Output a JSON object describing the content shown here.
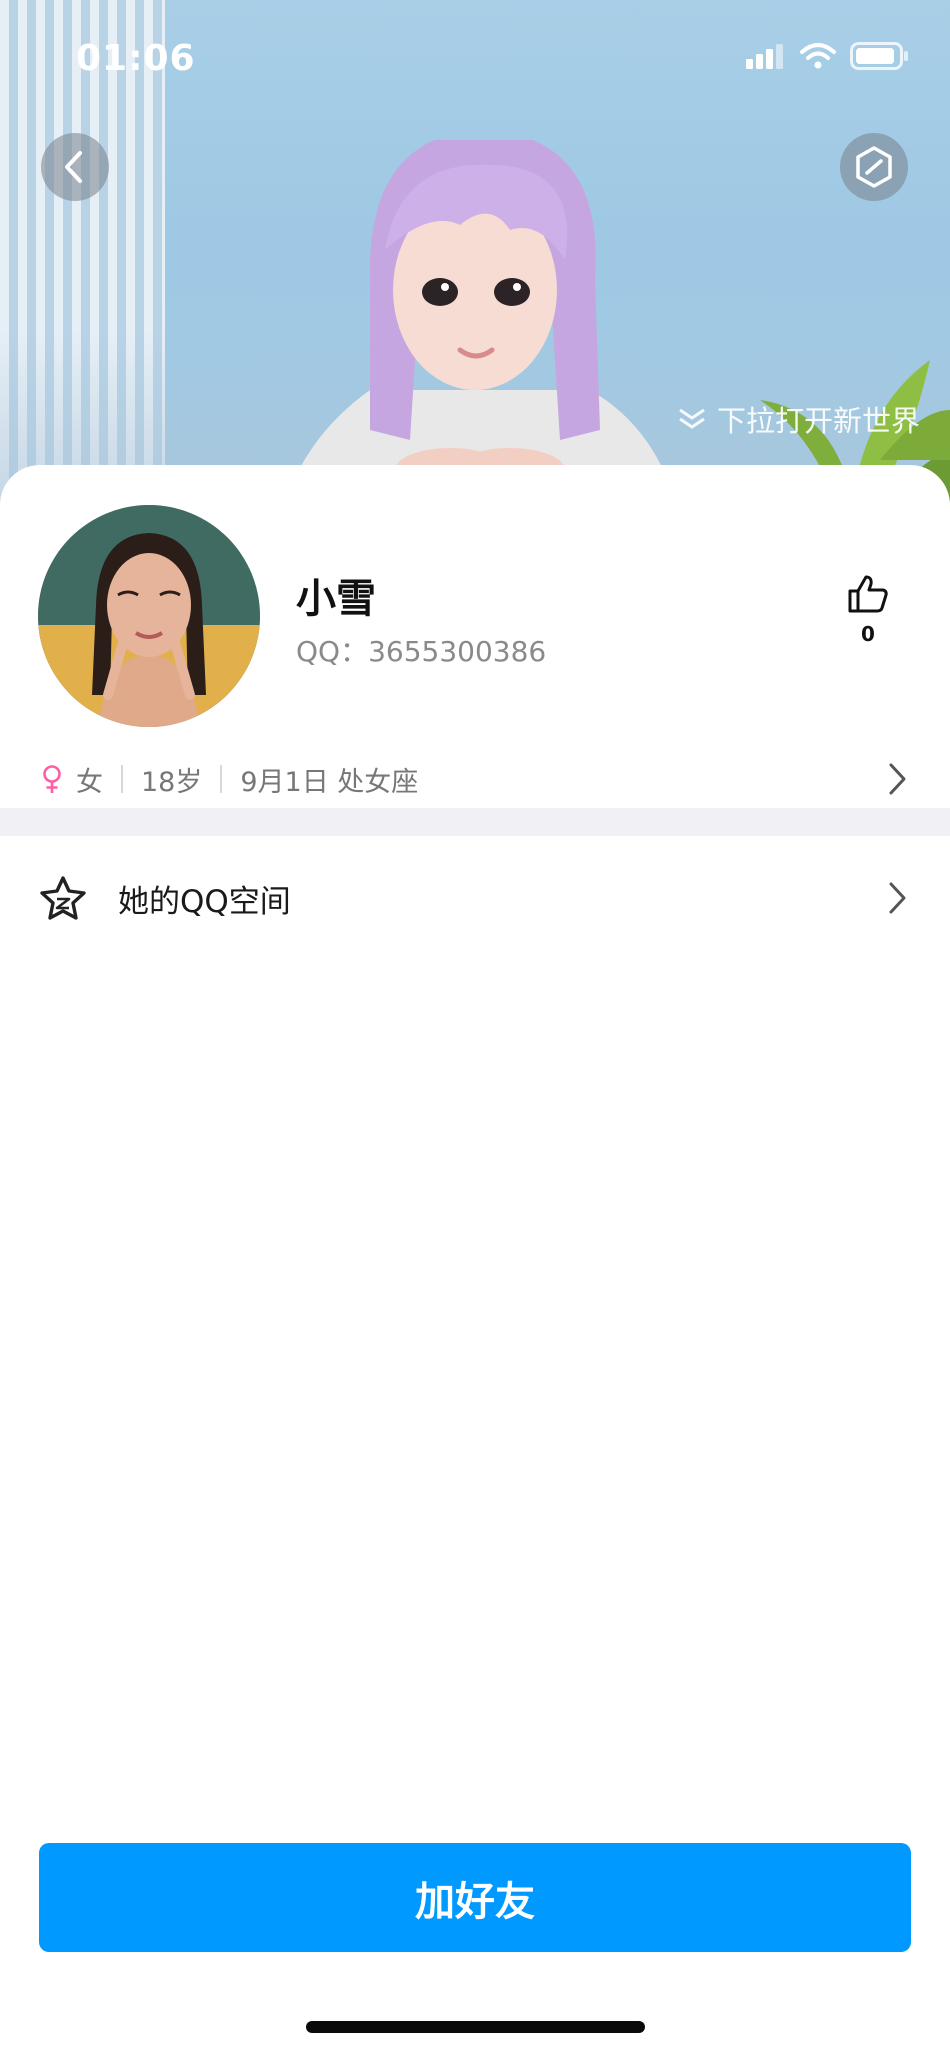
{
  "status_bar": {
    "time": "01:06"
  },
  "hero": {
    "hint": "下拉打开新世界"
  },
  "profile": {
    "name": "小雪",
    "qq_label": "QQ：",
    "qq_number": "3655300386",
    "likes": "0",
    "gender": "女",
    "age": "18岁",
    "birthday": "9月1日 处女座"
  },
  "menu": {
    "qzone_label": "她的QQ空间"
  },
  "actions": {
    "add_friend": "加好友"
  },
  "colors": {
    "accent": "#0099ff",
    "female": "#ff5fa2"
  }
}
